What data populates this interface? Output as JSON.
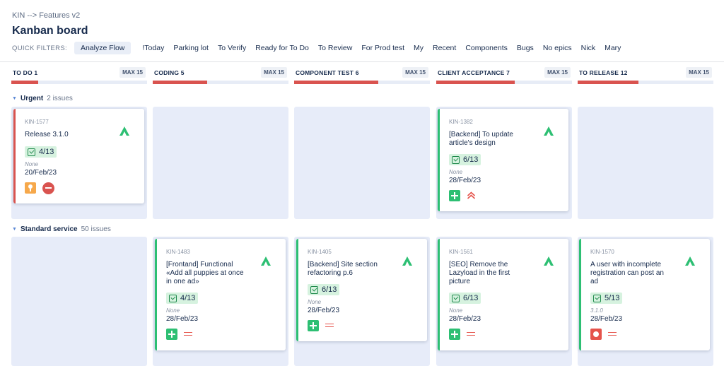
{
  "breadcrumb": "KIN --> Features v2",
  "title": "Kanban board",
  "quick_filters": {
    "label": "QUICK FILTERS:",
    "items": [
      "Analyze Flow",
      "!Today",
      "Parking lot",
      "To Verify",
      "Ready for To Do",
      "To Review",
      "For Prod test",
      "My",
      "Recent",
      "Components",
      "Bugs",
      "No epics",
      "Nick",
      "Mary"
    ],
    "active": "Analyze Flow"
  },
  "columns": [
    {
      "name": "TO DO 1",
      "max": "MAX 15",
      "progress": 0.2
    },
    {
      "name": "CODING 5",
      "max": "MAX 15",
      "progress": 0.4
    },
    {
      "name": "COMPONENT TEST 6",
      "max": "MAX 15",
      "progress": 0.62
    },
    {
      "name": "CLIENT ACCEPTANCE 7",
      "max": "MAX 15",
      "progress": 0.58
    },
    {
      "name": "TO RELEASE 12",
      "max": "MAX 15",
      "progress": 0.45
    }
  ],
  "swimlanes": [
    {
      "name": "Urgent",
      "count": "2 issues"
    },
    {
      "name": "Standard service",
      "count": "50 issues"
    }
  ],
  "cards": [
    {
      "key": "KIN-1577",
      "summary": "Release 3.1.0",
      "subtasks": "4/13",
      "version": "None",
      "due": "20/Feb/23",
      "type_icon": "idea-icon",
      "priority_icon": "blocker-icon",
      "assignee_icon": "assignee-a-icon",
      "accent": "#d9534f"
    },
    {
      "key": "KIN-1382",
      "summary": "[Backend] To update article's design",
      "subtasks": "6/13",
      "version": "None",
      "due": "28/Feb/23",
      "type_icon": "story-icon",
      "priority_icon": "highest-priority-icon",
      "assignee_icon": "assignee-a-icon",
      "accent": "#2dbf73"
    },
    {
      "key": "KIN-1483",
      "summary": "[Frontand] Functional «Add all puppies at once in one ad»",
      "subtasks": "4/13",
      "version": "None",
      "due": "28/Feb/23",
      "type_icon": "story-icon",
      "priority_icon": "medium-priority-icon",
      "assignee_icon": "assignee-a-icon",
      "accent": "#2dbf73"
    },
    {
      "key": "KIN-1405",
      "summary": "[Backend] Site section refactoring p.6",
      "subtasks": "6/13",
      "version": "None",
      "due": "28/Feb/23",
      "type_icon": "story-icon",
      "priority_icon": "medium-priority-icon",
      "assignee_icon": "assignee-a-icon",
      "accent": "#2dbf73"
    },
    {
      "key": "KIN-1561",
      "summary": "[SEO] Remove the Lazyload in the first picture",
      "subtasks": "6/13",
      "version": "None",
      "due": "28/Feb/23",
      "type_icon": "story-icon",
      "priority_icon": "medium-priority-icon",
      "assignee_icon": "assignee-a-icon",
      "accent": "#2dbf73"
    },
    {
      "key": "KIN-1570",
      "summary": "A user with incomplete registration can post an ad",
      "subtasks": "5/13",
      "version": "3.1.0",
      "due": "28/Feb/23",
      "type_icon": "bug-icon",
      "priority_icon": "medium-priority-icon",
      "assignee_icon": "assignee-a-icon",
      "accent": "#2dbf73"
    }
  ],
  "colors": {
    "accent_green": "#2dbf73",
    "accent_red": "#d9534f",
    "lane_bg": "#e7ecf9"
  }
}
